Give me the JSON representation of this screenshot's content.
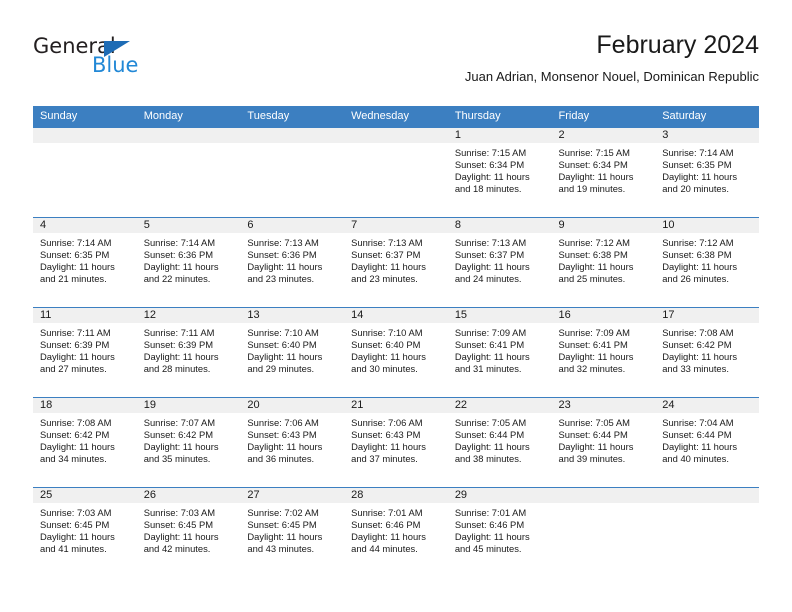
{
  "brand": {
    "name_part1": "General",
    "name_part2": "Blue",
    "triangle_color": "#1e6cb5",
    "blue_color": "#2288d6"
  },
  "header": {
    "title": "February 2024",
    "subtitle": "Juan Adrian, Monsenor Nouel, Dominican Republic"
  },
  "theme": {
    "header_blue": "#3c7fc1",
    "daynum_band": "#f0f0f0",
    "text": "#1a1a1a"
  },
  "weekday_headers": [
    "Sunday",
    "Monday",
    "Tuesday",
    "Wednesday",
    "Thursday",
    "Friday",
    "Saturday"
  ],
  "weeks": [
    [
      {
        "day": "",
        "sunrise": "",
        "sunset": "",
        "daylight_line1": "",
        "daylight_line2": ""
      },
      {
        "day": "",
        "sunrise": "",
        "sunset": "",
        "daylight_line1": "",
        "daylight_line2": ""
      },
      {
        "day": "",
        "sunrise": "",
        "sunset": "",
        "daylight_line1": "",
        "daylight_line2": ""
      },
      {
        "day": "",
        "sunrise": "",
        "sunset": "",
        "daylight_line1": "",
        "daylight_line2": ""
      },
      {
        "day": "1",
        "sunrise": "Sunrise: 7:15 AM",
        "sunset": "Sunset: 6:34 PM",
        "daylight_line1": "Daylight: 11 hours",
        "daylight_line2": "and 18 minutes."
      },
      {
        "day": "2",
        "sunrise": "Sunrise: 7:15 AM",
        "sunset": "Sunset: 6:34 PM",
        "daylight_line1": "Daylight: 11 hours",
        "daylight_line2": "and 19 minutes."
      },
      {
        "day": "3",
        "sunrise": "Sunrise: 7:14 AM",
        "sunset": "Sunset: 6:35 PM",
        "daylight_line1": "Daylight: 11 hours",
        "daylight_line2": "and 20 minutes."
      }
    ],
    [
      {
        "day": "4",
        "sunrise": "Sunrise: 7:14 AM",
        "sunset": "Sunset: 6:35 PM",
        "daylight_line1": "Daylight: 11 hours",
        "daylight_line2": "and 21 minutes."
      },
      {
        "day": "5",
        "sunrise": "Sunrise: 7:14 AM",
        "sunset": "Sunset: 6:36 PM",
        "daylight_line1": "Daylight: 11 hours",
        "daylight_line2": "and 22 minutes."
      },
      {
        "day": "6",
        "sunrise": "Sunrise: 7:13 AM",
        "sunset": "Sunset: 6:36 PM",
        "daylight_line1": "Daylight: 11 hours",
        "daylight_line2": "and 23 minutes."
      },
      {
        "day": "7",
        "sunrise": "Sunrise: 7:13 AM",
        "sunset": "Sunset: 6:37 PM",
        "daylight_line1": "Daylight: 11 hours",
        "daylight_line2": "and 23 minutes."
      },
      {
        "day": "8",
        "sunrise": "Sunrise: 7:13 AM",
        "sunset": "Sunset: 6:37 PM",
        "daylight_line1": "Daylight: 11 hours",
        "daylight_line2": "and 24 minutes."
      },
      {
        "day": "9",
        "sunrise": "Sunrise: 7:12 AM",
        "sunset": "Sunset: 6:38 PM",
        "daylight_line1": "Daylight: 11 hours",
        "daylight_line2": "and 25 minutes."
      },
      {
        "day": "10",
        "sunrise": "Sunrise: 7:12 AM",
        "sunset": "Sunset: 6:38 PM",
        "daylight_line1": "Daylight: 11 hours",
        "daylight_line2": "and 26 minutes."
      }
    ],
    [
      {
        "day": "11",
        "sunrise": "Sunrise: 7:11 AM",
        "sunset": "Sunset: 6:39 PM",
        "daylight_line1": "Daylight: 11 hours",
        "daylight_line2": "and 27 minutes."
      },
      {
        "day": "12",
        "sunrise": "Sunrise: 7:11 AM",
        "sunset": "Sunset: 6:39 PM",
        "daylight_line1": "Daylight: 11 hours",
        "daylight_line2": "and 28 minutes."
      },
      {
        "day": "13",
        "sunrise": "Sunrise: 7:10 AM",
        "sunset": "Sunset: 6:40 PM",
        "daylight_line1": "Daylight: 11 hours",
        "daylight_line2": "and 29 minutes."
      },
      {
        "day": "14",
        "sunrise": "Sunrise: 7:10 AM",
        "sunset": "Sunset: 6:40 PM",
        "daylight_line1": "Daylight: 11 hours",
        "daylight_line2": "and 30 minutes."
      },
      {
        "day": "15",
        "sunrise": "Sunrise: 7:09 AM",
        "sunset": "Sunset: 6:41 PM",
        "daylight_line1": "Daylight: 11 hours",
        "daylight_line2": "and 31 minutes."
      },
      {
        "day": "16",
        "sunrise": "Sunrise: 7:09 AM",
        "sunset": "Sunset: 6:41 PM",
        "daylight_line1": "Daylight: 11 hours",
        "daylight_line2": "and 32 minutes."
      },
      {
        "day": "17",
        "sunrise": "Sunrise: 7:08 AM",
        "sunset": "Sunset: 6:42 PM",
        "daylight_line1": "Daylight: 11 hours",
        "daylight_line2": "and 33 minutes."
      }
    ],
    [
      {
        "day": "18",
        "sunrise": "Sunrise: 7:08 AM",
        "sunset": "Sunset: 6:42 PM",
        "daylight_line1": "Daylight: 11 hours",
        "daylight_line2": "and 34 minutes."
      },
      {
        "day": "19",
        "sunrise": "Sunrise: 7:07 AM",
        "sunset": "Sunset: 6:42 PM",
        "daylight_line1": "Daylight: 11 hours",
        "daylight_line2": "and 35 minutes."
      },
      {
        "day": "20",
        "sunrise": "Sunrise: 7:06 AM",
        "sunset": "Sunset: 6:43 PM",
        "daylight_line1": "Daylight: 11 hours",
        "daylight_line2": "and 36 minutes."
      },
      {
        "day": "21",
        "sunrise": "Sunrise: 7:06 AM",
        "sunset": "Sunset: 6:43 PM",
        "daylight_line1": "Daylight: 11 hours",
        "daylight_line2": "and 37 minutes."
      },
      {
        "day": "22",
        "sunrise": "Sunrise: 7:05 AM",
        "sunset": "Sunset: 6:44 PM",
        "daylight_line1": "Daylight: 11 hours",
        "daylight_line2": "and 38 minutes."
      },
      {
        "day": "23",
        "sunrise": "Sunrise: 7:05 AM",
        "sunset": "Sunset: 6:44 PM",
        "daylight_line1": "Daylight: 11 hours",
        "daylight_line2": "and 39 minutes."
      },
      {
        "day": "24",
        "sunrise": "Sunrise: 7:04 AM",
        "sunset": "Sunset: 6:44 PM",
        "daylight_line1": "Daylight: 11 hours",
        "daylight_line2": "and 40 minutes."
      }
    ],
    [
      {
        "day": "25",
        "sunrise": "Sunrise: 7:03 AM",
        "sunset": "Sunset: 6:45 PM",
        "daylight_line1": "Daylight: 11 hours",
        "daylight_line2": "and 41 minutes."
      },
      {
        "day": "26",
        "sunrise": "Sunrise: 7:03 AM",
        "sunset": "Sunset: 6:45 PM",
        "daylight_line1": "Daylight: 11 hours",
        "daylight_line2": "and 42 minutes."
      },
      {
        "day": "27",
        "sunrise": "Sunrise: 7:02 AM",
        "sunset": "Sunset: 6:45 PM",
        "daylight_line1": "Daylight: 11 hours",
        "daylight_line2": "and 43 minutes."
      },
      {
        "day": "28",
        "sunrise": "Sunrise: 7:01 AM",
        "sunset": "Sunset: 6:46 PM",
        "daylight_line1": "Daylight: 11 hours",
        "daylight_line2": "and 44 minutes."
      },
      {
        "day": "29",
        "sunrise": "Sunrise: 7:01 AM",
        "sunset": "Sunset: 6:46 PM",
        "daylight_line1": "Daylight: 11 hours",
        "daylight_line2": "and 45 minutes."
      },
      {
        "day": "",
        "sunrise": "",
        "sunset": "",
        "daylight_line1": "",
        "daylight_line2": ""
      },
      {
        "day": "",
        "sunrise": "",
        "sunset": "",
        "daylight_line1": "",
        "daylight_line2": ""
      }
    ]
  ]
}
